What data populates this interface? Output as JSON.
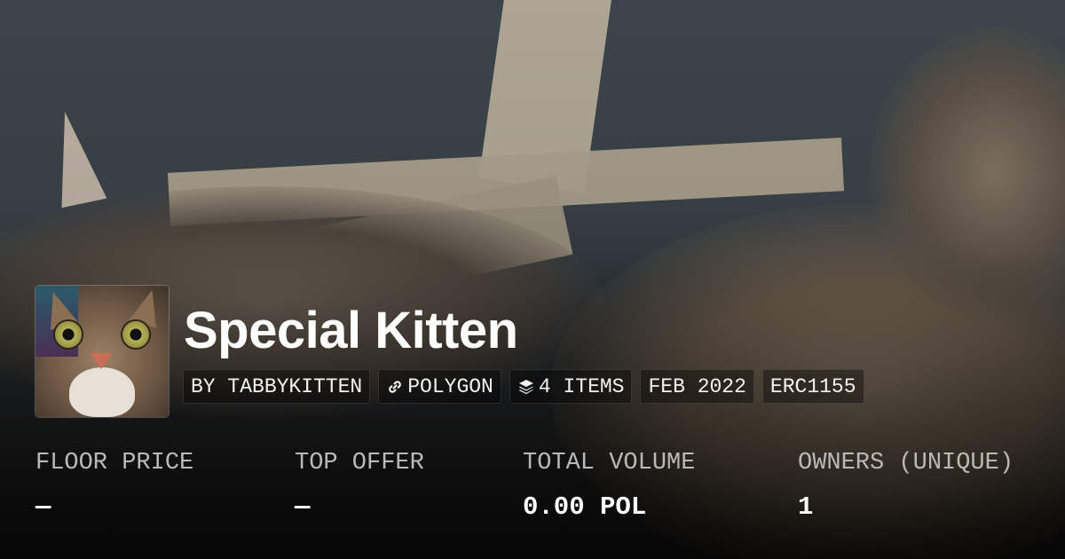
{
  "collection": {
    "title": "Special Kitten",
    "avatar_alt": "kitten avatar"
  },
  "pills": [
    {
      "icon": "",
      "label": "BY TABBYKITTEN"
    },
    {
      "icon": "link-icon",
      "label": "POLYGON"
    },
    {
      "icon": "layers-icon",
      "label": "4 ITEMS"
    },
    {
      "icon": "",
      "label": "FEB 2022"
    },
    {
      "icon": "",
      "label": "ERC1155"
    }
  ],
  "stats": [
    {
      "label": "FLOOR PRICE",
      "value": "—"
    },
    {
      "label": "TOP OFFER",
      "value": "—"
    },
    {
      "label": "TOTAL VOLUME",
      "value": "0.00 POL"
    },
    {
      "label": "OWNERS (UNIQUE)",
      "value": "1"
    }
  ]
}
